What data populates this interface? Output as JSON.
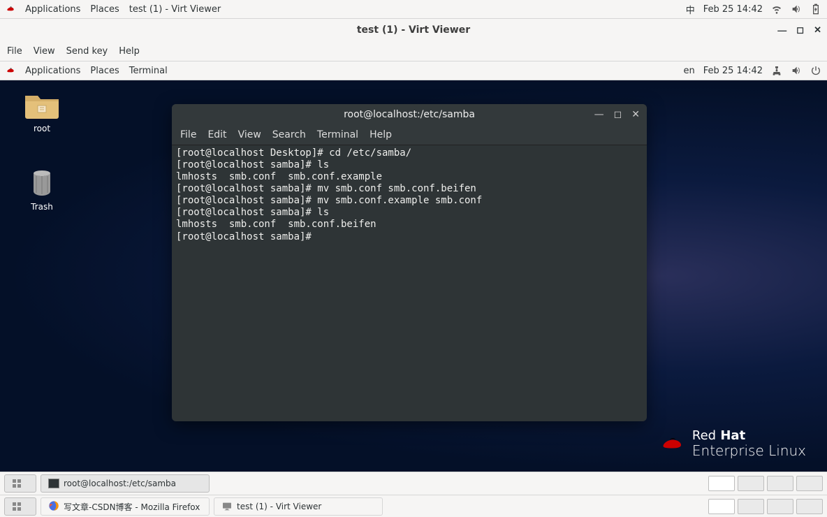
{
  "host": {
    "topbar": {
      "applications": "Applications",
      "places": "Places",
      "active_app": "test (1) - Virt Viewer",
      "input_method": "中",
      "datetime": "Feb 25  14:42"
    },
    "taskbar": {
      "item1": "写文章-CSDN博客 - Mozilla Firefox",
      "item2": "test (1) - Virt Viewer"
    }
  },
  "virtviewer": {
    "title": "test (1) - Virt Viewer",
    "menu": {
      "file": "File",
      "view": "View",
      "sendkey": "Send key",
      "help": "Help"
    }
  },
  "guest": {
    "topbar": {
      "applications": "Applications",
      "places": "Places",
      "active_app": "Terminal",
      "lang": "en",
      "datetime": "Feb 25  14:42"
    },
    "desktop": {
      "root_label": "root",
      "trash_label": "Trash"
    },
    "brand": {
      "line1a": "Red",
      "line1b": "Hat",
      "line2": "Enterprise Linux"
    },
    "terminal": {
      "title": "root@localhost:/etc/samba",
      "menu": {
        "file": "File",
        "edit": "Edit",
        "view": "View",
        "search": "Search",
        "terminal": "Terminal",
        "help": "Help"
      },
      "content": "[root@localhost Desktop]# cd /etc/samba/\n[root@localhost samba]# ls\nlmhosts  smb.conf  smb.conf.example\n[root@localhost samba]# mv smb.conf smb.conf.beifen\n[root@localhost samba]# mv smb.conf.example smb.conf\n[root@localhost samba]# ls\nlmhosts  smb.conf  smb.conf.beifen\n[root@localhost samba]# "
    },
    "taskbar": {
      "item1": "root@localhost:/etc/samba"
    }
  }
}
